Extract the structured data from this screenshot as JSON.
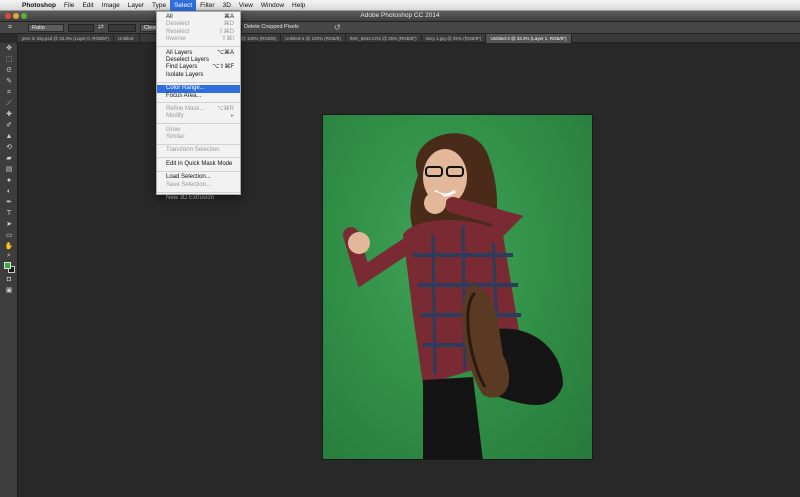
{
  "menubar": {
    "apple": "",
    "items": [
      "Photoshop",
      "File",
      "Edit",
      "Image",
      "Layer",
      "Type",
      "Select",
      "Filter",
      "3D",
      "View",
      "Window",
      "Help"
    ]
  },
  "window": {
    "title": "Adobe Photoshop CC 2014"
  },
  "options": {
    "ratio": "Ratio",
    "clear": "Clear",
    "delete_cropped": "Delete Cropped Pixels"
  },
  "tabs": [
    "jenn in Sky.psd @ 33.3% (Layer 0, RGB/8*)",
    "Untitled-",
    "sky-458-706.jpg @ 100% (RGB/8)",
    "Untitled-2 @ 100% (RGB/8)",
    "IMG_6844.CR2 @ 25% (RGB/8*)",
    "sexy 1.jpg @ 25% (RGB/8*)",
    "Untitled-3 @ 33.3% (Layer 1, RGB/8*)"
  ],
  "select_menu": {
    "items": [
      {
        "label": "All",
        "shortcut": "⌘A",
        "disabled": false
      },
      {
        "label": "Deselect",
        "shortcut": "⌘D",
        "disabled": true
      },
      {
        "label": "Reselect",
        "shortcut": "⇧⌘D",
        "disabled": true
      },
      {
        "label": "Inverse",
        "shortcut": "⇧⌘I",
        "disabled": true
      },
      {
        "sep": true
      },
      {
        "label": "All Layers",
        "shortcut": "⌥⌘A",
        "disabled": false
      },
      {
        "label": "Deselect Layers",
        "shortcut": "",
        "disabled": false
      },
      {
        "label": "Find Layers",
        "shortcut": "⌥⇧⌘F",
        "disabled": false
      },
      {
        "label": "Isolate Layers",
        "shortcut": "",
        "disabled": false
      },
      {
        "sep": true
      },
      {
        "label": "Color Range...",
        "shortcut": "",
        "disabled": false,
        "highlight": true
      },
      {
        "label": "Focus Area...",
        "shortcut": "",
        "disabled": false
      },
      {
        "sep": true
      },
      {
        "label": "Refine Mask...",
        "shortcut": "⌥⌘R",
        "disabled": true
      },
      {
        "label": "Modify",
        "shortcut": "",
        "disabled": true,
        "submenu": true
      },
      {
        "sep": true
      },
      {
        "label": "Grow",
        "shortcut": "",
        "disabled": true
      },
      {
        "label": "Similar",
        "shortcut": "",
        "disabled": true
      },
      {
        "sep": true
      },
      {
        "label": "Transform Selection",
        "shortcut": "",
        "disabled": true
      },
      {
        "sep": true
      },
      {
        "label": "Edit in Quick Mask Mode",
        "shortcut": "",
        "disabled": false
      },
      {
        "sep": true
      },
      {
        "label": "Load Selection...",
        "shortcut": "",
        "disabled": false
      },
      {
        "label": "Save Selection...",
        "shortcut": "",
        "disabled": true
      },
      {
        "sep": true
      },
      {
        "label": "New 3D Extrusion",
        "shortcut": "",
        "disabled": true
      }
    ]
  },
  "tools": [
    "move-icon",
    "marquee-icon",
    "lasso-icon",
    "quick-select-icon",
    "crop-icon",
    "eyedropper-icon",
    "healing-icon",
    "brush-icon",
    "clone-stamp-icon",
    "history-brush-icon",
    "eraser-icon",
    "gradient-icon",
    "blur-icon",
    "dodge-icon",
    "pen-icon",
    "type-icon",
    "path-select-icon",
    "shape-icon",
    "hand-icon",
    "zoom-icon"
  ],
  "colors": {
    "accent": "#2f6fdc",
    "foreground_swatch": "#2fae3e",
    "background_swatch": "#1d1d1d"
  }
}
